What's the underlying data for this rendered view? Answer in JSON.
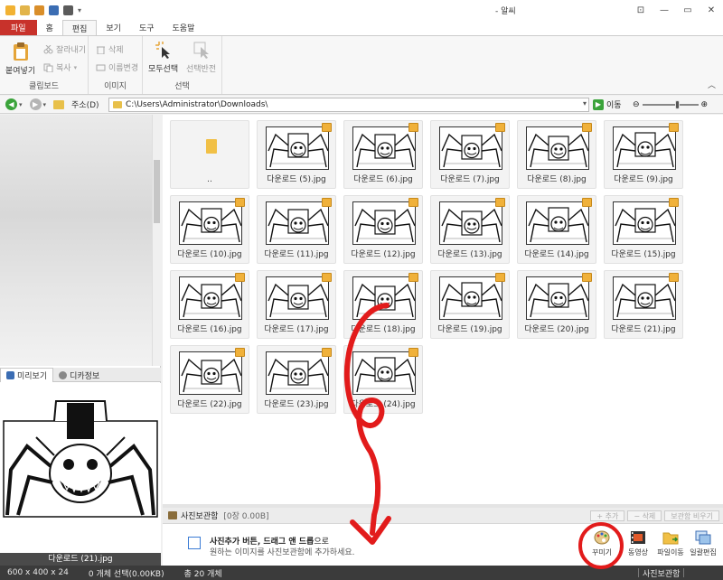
{
  "window": {
    "title": "- 알씨",
    "buttons": [
      "⊡",
      "—",
      "▭",
      "✕"
    ]
  },
  "ribbon": {
    "tabs": [
      "파일",
      "홈",
      "편집",
      "보기",
      "도구",
      "도움말"
    ],
    "active_tab": "편집",
    "clipboard": {
      "paste": "붙여넣기",
      "cut": "잘라내기",
      "copy": "복사",
      "group": "클립보드"
    },
    "image": {
      "delete": "삭제",
      "rename": "이름변경",
      "group": "이미지"
    },
    "select": {
      "select_all": "모두선택",
      "invert": "선택반전",
      "group": "선택"
    }
  },
  "address": {
    "label": "주소(D)",
    "path": "C:\\Users\\Administrator\\Downloads\\",
    "go": "이동"
  },
  "left_panel": {
    "tabs": [
      "미리보기",
      "디카정보"
    ],
    "preview_caption": "다운로드 (21).jpg"
  },
  "grid": {
    "items": [
      {
        "caption": "..",
        "type": "folder"
      },
      {
        "caption": "다운로드 (5).jpg"
      },
      {
        "caption": "다운로드 (6).jpg"
      },
      {
        "caption": "다운로드 (7).jpg"
      },
      {
        "caption": "다운로드 (8).jpg"
      },
      {
        "caption": "다운로드 (9).jpg"
      },
      {
        "caption": "다운로드 (10).jpg"
      },
      {
        "caption": "다운로드 (11).jpg"
      },
      {
        "caption": "다운로드 (12).jpg"
      },
      {
        "caption": "다운로드 (13).jpg"
      },
      {
        "caption": "다운로드 (14).jpg"
      },
      {
        "caption": "다운로드 (15).jpg"
      },
      {
        "caption": "다운로드 (16).jpg"
      },
      {
        "caption": "다운로드 (17).jpg"
      },
      {
        "caption": "다운로드 (18).jpg"
      },
      {
        "caption": "다운로드 (19).jpg"
      },
      {
        "caption": "다운로드 (20).jpg"
      },
      {
        "caption": "다운로드 (21).jpg"
      },
      {
        "caption": "다운로드 (22).jpg"
      },
      {
        "caption": "다운로드 (23).jpg"
      },
      {
        "caption": "다운로드 (24).jpg"
      }
    ]
  },
  "storage": {
    "title": "사진보관함",
    "count": "[0장 0.00B]",
    "buttons": [
      "+ 추가",
      "− 삭제",
      "보관함 비우기"
    ],
    "hint_bold": "사진추가 버튼, 드래그 앤 드롭",
    "hint_suffix": "으로",
    "hint_line2": "원하는 이미지를 사진보관함에 추가하세요.",
    "tools": [
      "꾸미기",
      "동영상",
      "파일이동",
      "일괄편집"
    ]
  },
  "status": {
    "dims": "600 x 400 x 24",
    "selected": "0 개체 선택(0.00KB)",
    "total": "총 20 개체",
    "right_label": "사진보관함"
  },
  "colors": {
    "file_tab": "#c8322b",
    "status_bg": "#3b3b3b",
    "annotation": "#e21b1b"
  }
}
